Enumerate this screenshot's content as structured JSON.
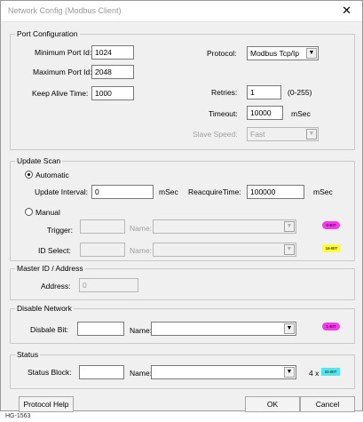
{
  "window": {
    "title": "Network Config (Modbus Client)",
    "close_glyph": "✕"
  },
  "port_config": {
    "legend": "Port Configuration",
    "min_port_label": "Minimum Port Id:",
    "min_port_value": "1024",
    "max_port_label": "Maximum Port Id:",
    "max_port_value": "2048",
    "keep_alive_label": "Keep Alive Time:",
    "keep_alive_value": "1000",
    "protocol_label": "Protocol:",
    "protocol_value": "Modbus Tcp/Ip",
    "retries_label": "Retries:",
    "retries_value": "1",
    "retries_range": "(0-255)",
    "timeout_label": "Timeout:",
    "timeout_value": "10000",
    "timeout_unit": "mSec",
    "slave_speed_label": "Slave Speed:",
    "slave_speed_value": "Fast"
  },
  "update_scan": {
    "legend": "Update Scan",
    "automatic_label": "Automatic",
    "automatic_selected": true,
    "update_interval_label": "Update Interval:",
    "update_interval_value": "0",
    "update_interval_unit": "mSec",
    "reacquire_label": "ReacquireTime:",
    "reacquire_value": "100000",
    "reacquire_unit": "mSec",
    "manual_label": "Manual",
    "trigger_label": "Trigger:",
    "trigger_name_label": "Name:",
    "trigger_badge": "0-BIT",
    "id_select_label": "ID Select:",
    "id_select_name_label": "Name:",
    "id_select_badge": "16-BIT"
  },
  "master_id": {
    "legend": "Master ID / Address",
    "address_label": "Address:",
    "address_value": "0"
  },
  "disable_network": {
    "legend": "Disable Network",
    "disable_bit_label": "Disbale Bit:",
    "name_label": "Name:",
    "badge": "1-BIT"
  },
  "status": {
    "legend": "Status",
    "status_block_label": "Status Block:",
    "name_label": "Name:",
    "multiplier": "4 x",
    "badge": "32-BIT"
  },
  "buttons": {
    "help": "Protocol Help",
    "ok": "OK",
    "cancel": "Cancel"
  },
  "footer": {
    "code": "HG-1563"
  },
  "icons": {
    "dropdown": "▼"
  }
}
